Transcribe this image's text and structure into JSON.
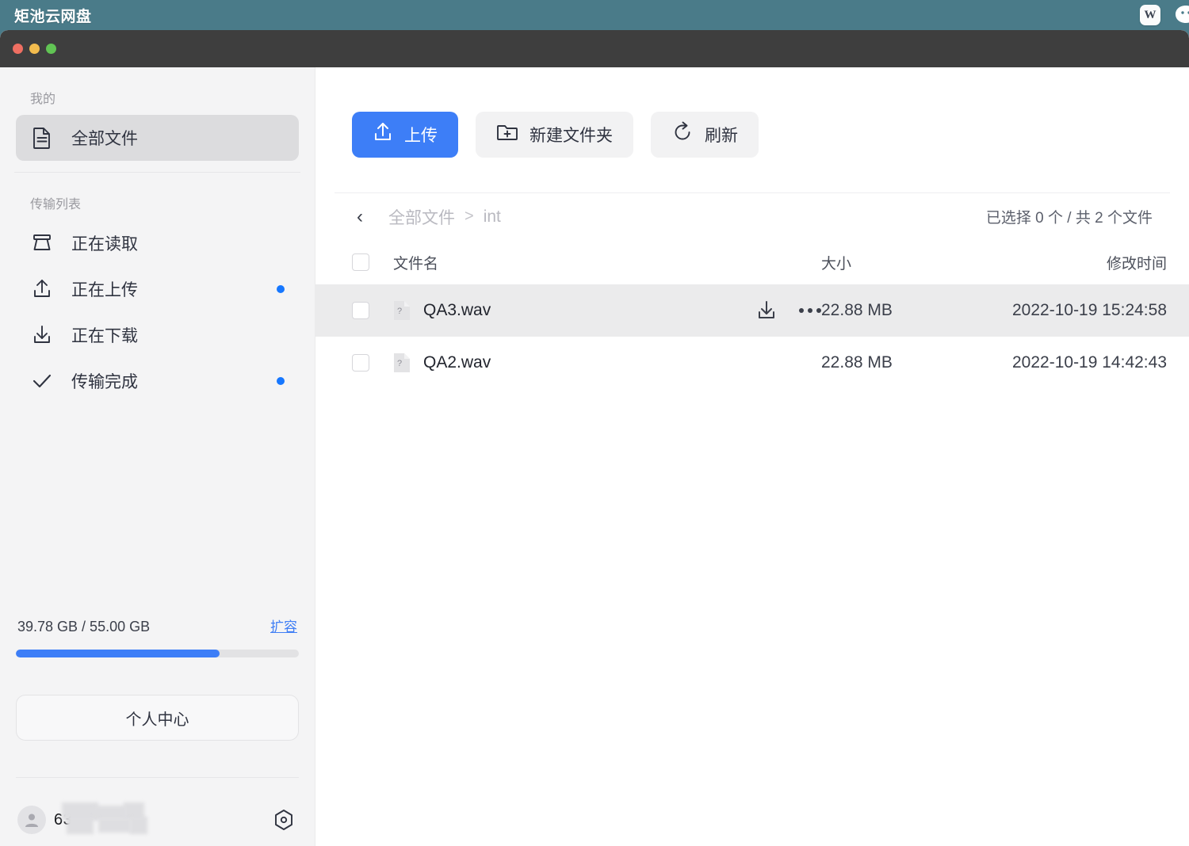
{
  "desktop": {
    "menubar_title": "矩池云网盘",
    "background_color": "#4a7b89",
    "tray_icons": [
      "wps-icon",
      "chat-bubble-icon"
    ],
    "wps_glyph": "W"
  },
  "window": {
    "titlebar_color": "#3e3e3e",
    "traffic_lights": [
      "close",
      "minimize",
      "maximize"
    ]
  },
  "sidebar": {
    "sections": [
      {
        "label": "我的",
        "items": [
          {
            "label": "全部文件",
            "icon": "document-icon",
            "selected": true,
            "badge": false
          }
        ]
      },
      {
        "label": "传输列表",
        "items": [
          {
            "label": "正在读取",
            "icon": "scanner-icon",
            "selected": false,
            "badge": false
          },
          {
            "label": "正在上传",
            "icon": "upload-icon",
            "selected": false,
            "badge": true
          },
          {
            "label": "正在下载",
            "icon": "download-icon",
            "selected": false,
            "badge": false
          },
          {
            "label": "传输完成",
            "icon": "check-icon",
            "selected": false,
            "badge": true
          }
        ]
      }
    ],
    "storage": {
      "text": "39.78 GB / 55.00 GB",
      "used_gb": 39.78,
      "total_gb": 55.0,
      "percent": 72,
      "expand_link": "扩容",
      "bar_color": "#3d7ef7"
    },
    "personal_center_button": "个人中心",
    "user": {
      "name": "63",
      "avatar": "person-icon",
      "settings_icon": "hex-gear-icon",
      "redacted": true
    }
  },
  "main": {
    "toolbar": [
      {
        "label": "上传",
        "icon": "upload-icon",
        "style": "primary"
      },
      {
        "label": "新建文件夹",
        "icon": "folder-plus-icon",
        "style": "ghost"
      },
      {
        "label": "刷新",
        "icon": "refresh-icon",
        "style": "ghost"
      }
    ],
    "breadcrumb": {
      "back_glyph": "‹",
      "items": [
        "全部文件",
        "int"
      ],
      "separator": ">"
    },
    "selection_count": "已选择 0 个 / 共 2 个文件",
    "table": {
      "headers": {
        "name": "文件名",
        "size": "大小",
        "time": "修改时间"
      },
      "rows": [
        {
          "name": "QA3.wav",
          "size": "22.88 MB",
          "time": "2022-10-19 15:24:58",
          "icon": "unknown-file-icon",
          "checked": false,
          "hovered": true,
          "actions": [
            "download-icon",
            "more-icon"
          ]
        },
        {
          "name": "QA2.wav",
          "size": "22.88 MB",
          "time": "2022-10-19 14:42:43",
          "icon": "unknown-file-icon",
          "checked": false,
          "hovered": false,
          "actions": []
        }
      ]
    }
  },
  "colors": {
    "accent": "#3d7ef7",
    "badge": "#1677ff",
    "sidebar_bg": "#f4f4f5",
    "selected_item": "#dcdcde",
    "hover_row": "#ebebec"
  }
}
